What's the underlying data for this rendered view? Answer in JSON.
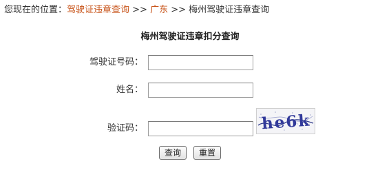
{
  "breadcrumb": {
    "prefix": "您现在的位置：",
    "link1": "驾驶证违章查询",
    "sep1": " >> ",
    "link2": "广东",
    "sep2": " >> ",
    "current": "梅州驾驶证违章查询"
  },
  "page_title": "梅州驾驶证违章扣分查询",
  "form": {
    "license_label": "驾驶证号码：",
    "license_value": "",
    "name_label": "姓名：",
    "name_value": "",
    "captcha_label": "验证码：",
    "captcha_value": "",
    "captcha_text": "he6k"
  },
  "buttons": {
    "query": "查询",
    "reset": "重置"
  },
  "colors": {
    "link": "#c8541a",
    "text": "#333333"
  }
}
